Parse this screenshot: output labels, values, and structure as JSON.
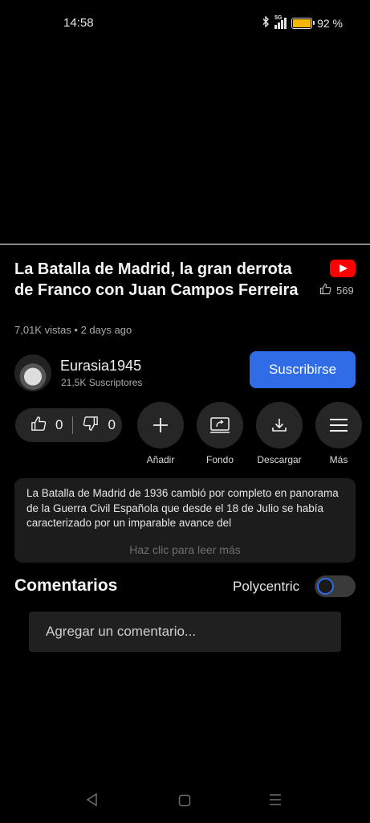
{
  "status": {
    "time": "14:58",
    "network": "5G",
    "battery_text": "92 %",
    "battery_level": 0.92,
    "battery_color": "#f2b705"
  },
  "video": {
    "title": "La Batalla de Madrid, la gran derrota de Franco con Juan Campos Ferreira",
    "likes": "569",
    "meta": "7,01K vistas • 2 days ago"
  },
  "channel": {
    "name": "Eurasia1945",
    "subscribers": "21,5K Suscriptores",
    "subscribe_label": "Suscribirse"
  },
  "reactions": {
    "likes": "0",
    "dislikes": "0"
  },
  "actions": [
    {
      "label": "Añadir",
      "icon": "plus-icon"
    },
    {
      "label": "Fondo",
      "icon": "background-play-icon"
    },
    {
      "label": "Descargar",
      "icon": "download-icon"
    },
    {
      "label": "Más",
      "icon": "menu-icon"
    }
  ],
  "description": {
    "text": "La Batalla de Madrid de 1936 cambió por completo en panorama de la Guerra Civil Española que desde el 18 de Julio se había caracterizado por un imparable avance del",
    "read_more": "Haz clic para leer más"
  },
  "comments": {
    "title": "Comentarios",
    "toggle_label": "Polycentric",
    "toggle_on": false,
    "placeholder": "Agregar un comentario..."
  },
  "colors": {
    "accent": "#2f6ce5",
    "youtube_red": "#ff0000",
    "background": "#000000"
  },
  "nav": {
    "back_icon": "back-triangle-icon",
    "home_icon": "home-square-icon",
    "recents_icon": "recents-lines-icon"
  }
}
